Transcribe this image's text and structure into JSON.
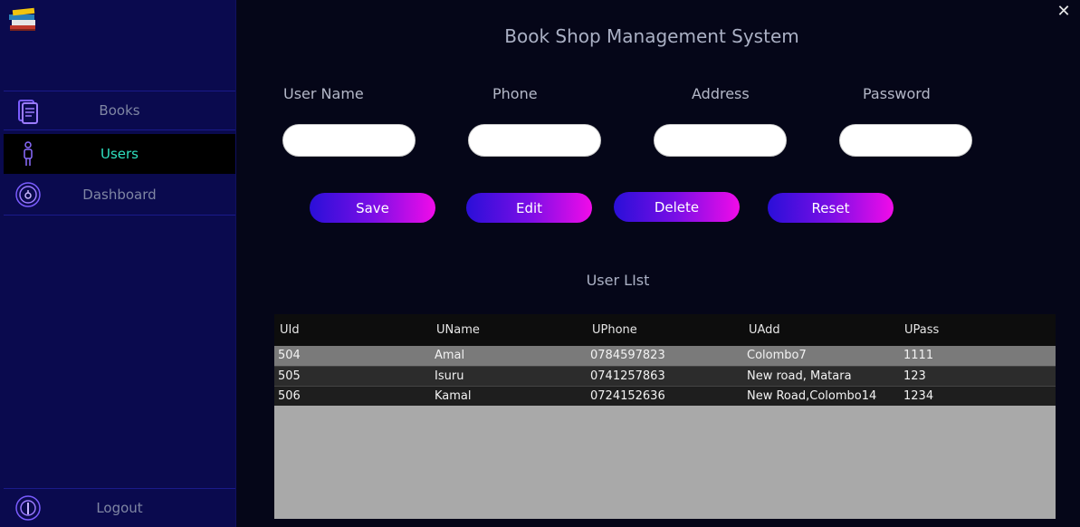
{
  "app": {
    "title": "Book Shop Management System"
  },
  "window": {
    "close_icon": "close-icon"
  },
  "sidebar": {
    "logo_icon": "books-stack-logo",
    "items": [
      {
        "label": "Books",
        "icon": "book-icon",
        "active": false
      },
      {
        "label": "Users",
        "icon": "user-icon",
        "active": true
      },
      {
        "label": "Dashboard",
        "icon": "dashboard-icon",
        "active": false
      }
    ],
    "logout": {
      "label": "Logout",
      "icon": "power-icon"
    }
  },
  "form": {
    "fields": [
      {
        "label": "User Name",
        "value": ""
      },
      {
        "label": "Phone",
        "value": ""
      },
      {
        "label": "Address",
        "value": ""
      },
      {
        "label": "Password",
        "value": ""
      }
    ],
    "buttons": {
      "save": "Save",
      "edit": "Edit",
      "delete": "Delete",
      "reset": "Reset"
    }
  },
  "user_list": {
    "title": "User LIst",
    "columns": [
      "UId",
      "UName",
      "UPhone",
      "UAdd",
      "UPass"
    ],
    "rows": [
      [
        "504",
        "Amal",
        "0784597823",
        "Colombo7",
        "1111"
      ],
      [
        "505",
        "Isuru",
        "0741257863",
        "New road, Matara",
        "123"
      ],
      [
        "506",
        "Kamal",
        "0724152636",
        "New Road,Colombo14",
        "1234"
      ]
    ],
    "selected_row": 0
  },
  "colors": {
    "sidebar_bg": "#0a0a4e",
    "main_bg": "#050618",
    "active_text": "#2fe0c0",
    "button_gradient_start": "#2a0fd8",
    "button_gradient_end": "#f10ce8"
  }
}
